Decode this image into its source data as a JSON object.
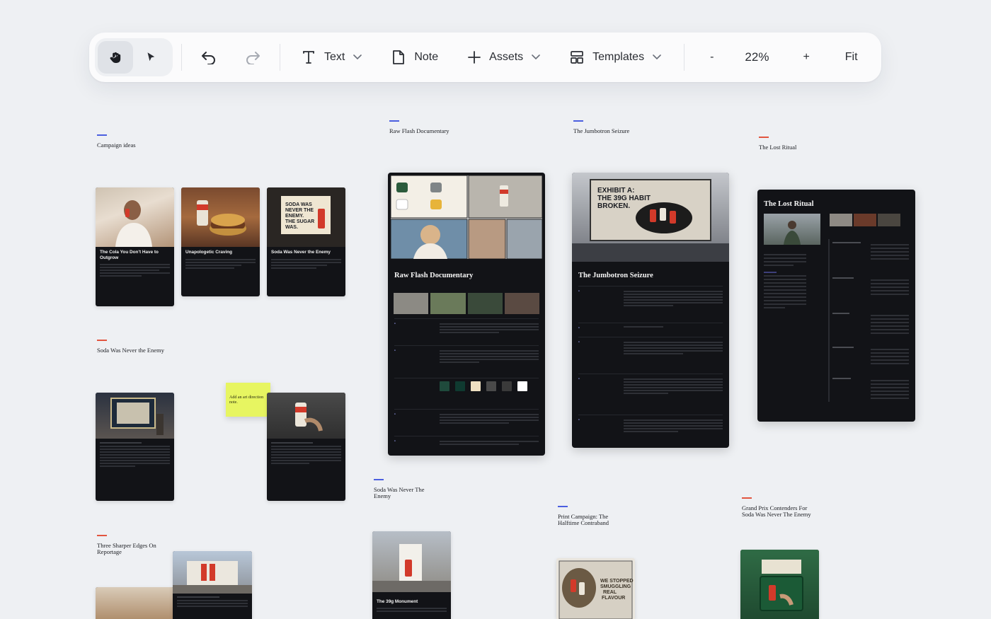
{
  "toolbar": {
    "text_label": "Text",
    "note_label": "Note",
    "assets_label": "Assets",
    "templates_label": "Templates",
    "zoom_out": "-",
    "zoom_level": "22%",
    "zoom_in": "+",
    "fit_label": "Fit",
    "icons": [
      "hand-icon",
      "pointer-icon",
      "undo-icon",
      "redo-icon",
      "text-icon",
      "chevron-down-icon",
      "note-icon",
      "plus-icon",
      "templates-icon"
    ]
  },
  "sections": {
    "campaign_ideas": {
      "title": "Campaign ideas"
    },
    "raw_flash": {
      "title": "Raw Flash Documentary"
    },
    "jumbotron": {
      "title": "The Jumbotron Seizure"
    },
    "lost_ritual": {
      "title": "The Lost Ritual"
    },
    "soda_enemy": {
      "title": "Soda Was Never the Enemy"
    },
    "soda_enemy_2": {
      "title": "Soda Was Never The Enemy"
    },
    "three_edges": {
      "title": "Three Sharper Edges On Reportage"
    },
    "print_campaign": {
      "title": "Print Campaign: The Halftime Contraband"
    },
    "grand_prix": {
      "title": "Grand Prix Contenders For Soda Was Never The Enemy"
    }
  },
  "cards": {
    "cola_outgrow": {
      "title": "The Cola You Don't Have to Outgrow"
    },
    "unapologetic": {
      "title": "Unapologetic Craving"
    },
    "never_enemy": {
      "title": "Soda Was Never the Enemy"
    },
    "monument": {
      "title": "The 39g Monument"
    }
  },
  "docs": {
    "raw_flash": {
      "title": "Raw Flash Documentary"
    },
    "jumbotron": {
      "title": "The Jumbotron Seizure"
    },
    "lost_ritual": {
      "title": "The Lost Ritual"
    }
  },
  "sticky": {
    "text": "Add an art direction note."
  },
  "art": {
    "billboard_text": "EXHIBIT A: THE 39G HABIT BROKEN.",
    "poster_text": "SODA WAS NEVER THE ENEMY. THE SUGAR WAS.",
    "print_text": "WE STOPPED SMUGGLING REAL FLAVOUR"
  },
  "palette": [
    "#1f4a3c",
    "#0f3a30",
    "#efe0c2",
    "#4a4a4a",
    "#3a3a3a",
    "#ffffff"
  ],
  "colors": {
    "accent": "#4b5fe0",
    "accent_red": "#e2553f",
    "canvas": "#eef0f3",
    "card": "#121317",
    "sticky": "#e7f561"
  }
}
